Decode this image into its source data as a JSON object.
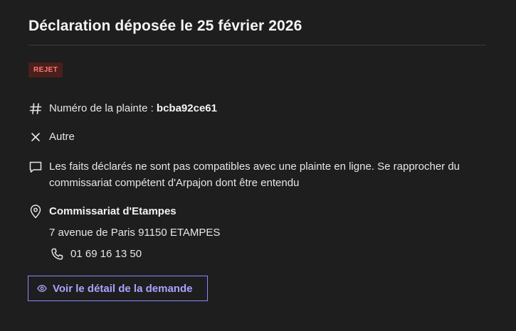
{
  "declaration": {
    "title": "Déclaration déposée le 25 février 2026",
    "status_badge": "REJET",
    "status_color": "#ff7a72",
    "number_label": "Numéro de la plainte : ",
    "number_value": "bcba92ce61",
    "type": "Autre",
    "reason": "Les faits déclarés ne sont pas compatibles avec une plainte en ligne. Se rapprocher du commissariat compétent d'Arpajon dont être entendu",
    "station": {
      "name": "Commissariat d'Etampes",
      "address": "7 avenue de Paris 91150 ETAMPES",
      "phone": "01 69 16 13 50"
    },
    "detail_button_label": "Voir le détail de la demande",
    "accent_color": "#a8a4ff"
  },
  "icons": {
    "number": "hash-icon",
    "type": "cross-icon",
    "reason": "message-icon",
    "station": "map-pin-icon",
    "phone": "phone-icon",
    "detail": "eye-icon"
  }
}
